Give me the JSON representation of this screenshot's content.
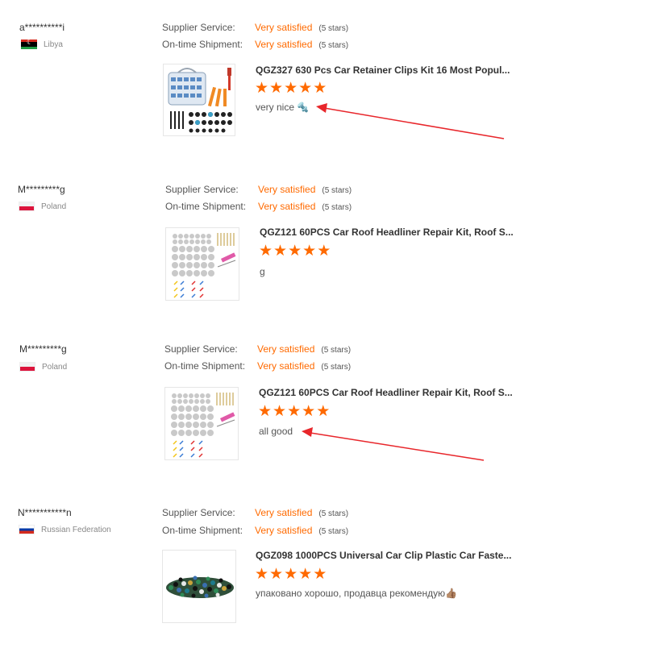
{
  "reviews": [
    {
      "buyer": "a**********i",
      "country": "Libya",
      "flag": "libya",
      "supplier_label": "Supplier Service:",
      "supplier_value": "Very satisfied",
      "supplier_note": "(5 stars)",
      "shipment_label": "On-time Shipment:",
      "shipment_value": "Very satisfied",
      "shipment_note": "(5 stars)",
      "product": "QGZ327 630 Pcs Car Retainer Clips Kit 16 Most Popul...",
      "stars": 5,
      "text": "very nice 🔩",
      "thumbnail": "clip-kit-case",
      "annotated": true
    },
    {
      "buyer": "M*********g",
      "country": "Poland",
      "flag": "poland",
      "supplier_label": "Supplier Service:",
      "supplier_value": "Very satisfied",
      "supplier_note": "(5 stars)",
      "shipment_label": "On-time Shipment:",
      "shipment_value": "Very satisfied",
      "shipment_note": "(5 stars)",
      "product": "QGZ121 60PCS Car Roof Headliner Repair Kit, Roof S...",
      "stars": 5,
      "text": "g",
      "thumbnail": "headliner-kit",
      "annotated": false
    },
    {
      "buyer": "M*********g",
      "country": "Poland",
      "flag": "poland",
      "supplier_label": "Supplier Service:",
      "supplier_value": "Very satisfied",
      "supplier_note": "(5 stars)",
      "shipment_label": "On-time Shipment:",
      "shipment_value": "Very satisfied",
      "shipment_note": "(5 stars)",
      "product": "QGZ121 60PCS Car Roof Headliner Repair Kit, Roof S...",
      "stars": 5,
      "text": "all good",
      "thumbnail": "headliner-kit",
      "annotated": true
    },
    {
      "buyer": "N***********n",
      "country": "Russian Federation",
      "flag": "russia",
      "supplier_label": "Supplier Service:",
      "supplier_value": "Very satisfied",
      "supplier_note": "(5 stars)",
      "shipment_label": "On-time Shipment:",
      "shipment_value": "Very satisfied",
      "shipment_note": "(5 stars)",
      "product": "QGZ098 1000PCS Universal Car Clip Plastic Car Faste...",
      "stars": 5,
      "text": "упаковано хорошо, продавца рекомендую👍🏽",
      "thumbnail": "clip-pile",
      "annotated": false
    }
  ],
  "colors": {
    "accent": "#ff6a00",
    "annotation_arrow": "#e8262b"
  }
}
